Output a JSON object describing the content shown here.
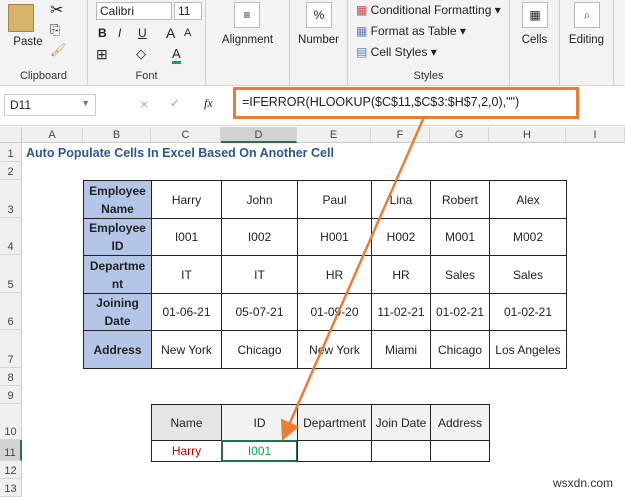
{
  "ribbon": {
    "clipboard": {
      "paste": "Paste",
      "label": "Clipboard"
    },
    "font": {
      "name": "Calibri",
      "size": "11",
      "bold": "B",
      "italic": "I",
      "underline": "U",
      "grow": "A",
      "shrink": "A",
      "color_a": "A",
      "label": "Font"
    },
    "alignment": {
      "label": "Alignment"
    },
    "number": {
      "label": "Number",
      "icon": "%"
    },
    "styles": {
      "conditional": "Conditional Formatting",
      "format_table": "Format as Table",
      "cell_styles": "Cell Styles",
      "label": "Styles"
    },
    "cells": {
      "label": "Cells"
    },
    "editing": {
      "label": "Editing"
    }
  },
  "formula_bar": {
    "name_box": "D11",
    "cancel": "×",
    "enter": "✓",
    "fx": "fx",
    "formula": "=IFERROR(HLOOKUP($C$11,$C$3:$H$7,2,0),\"\")"
  },
  "columns": [
    "A",
    "B",
    "C",
    "D",
    "E",
    "F",
    "G",
    "H",
    "I"
  ],
  "rows": [
    "1",
    "2",
    "3",
    "4",
    "5",
    "6",
    "7",
    "8",
    "9",
    "10",
    "11",
    "12",
    "13"
  ],
  "title": "Auto Populate Cells In Excel Based On Another Cell",
  "table": {
    "headers": [
      "Employee Name",
      "Employee ID",
      "Departme nt",
      "Joining Date",
      "Address"
    ],
    "rows": [
      [
        "Harry",
        "John",
        "Paul",
        "Lina",
        "Robert",
        "Alex"
      ],
      [
        "I001",
        "I002",
        "H001",
        "H002",
        "M001",
        "M002"
      ],
      [
        "IT",
        "IT",
        "HR",
        "HR",
        "Sales",
        "Sales"
      ],
      [
        "01-06-21",
        "05-07-21",
        "01-09-20",
        "11-02-21",
        "01-02-21",
        "01-02-21"
      ],
      [
        "New York",
        "Chicago",
        "New York",
        "Miami",
        "Chicago",
        "Los Angeles"
      ]
    ]
  },
  "lookup": {
    "headers": [
      "Name",
      "ID",
      "Department",
      "Join Date",
      "Address"
    ],
    "values": [
      "Harry",
      "I001",
      "",
      "",
      ""
    ]
  },
  "colors": {
    "accent": "#ed7d31",
    "title": "#2f5597",
    "header_fill": "#b4c6e7",
    "name_red": "#c00000",
    "id_green": "#00b050"
  },
  "watermark": "wsxdn.com"
}
